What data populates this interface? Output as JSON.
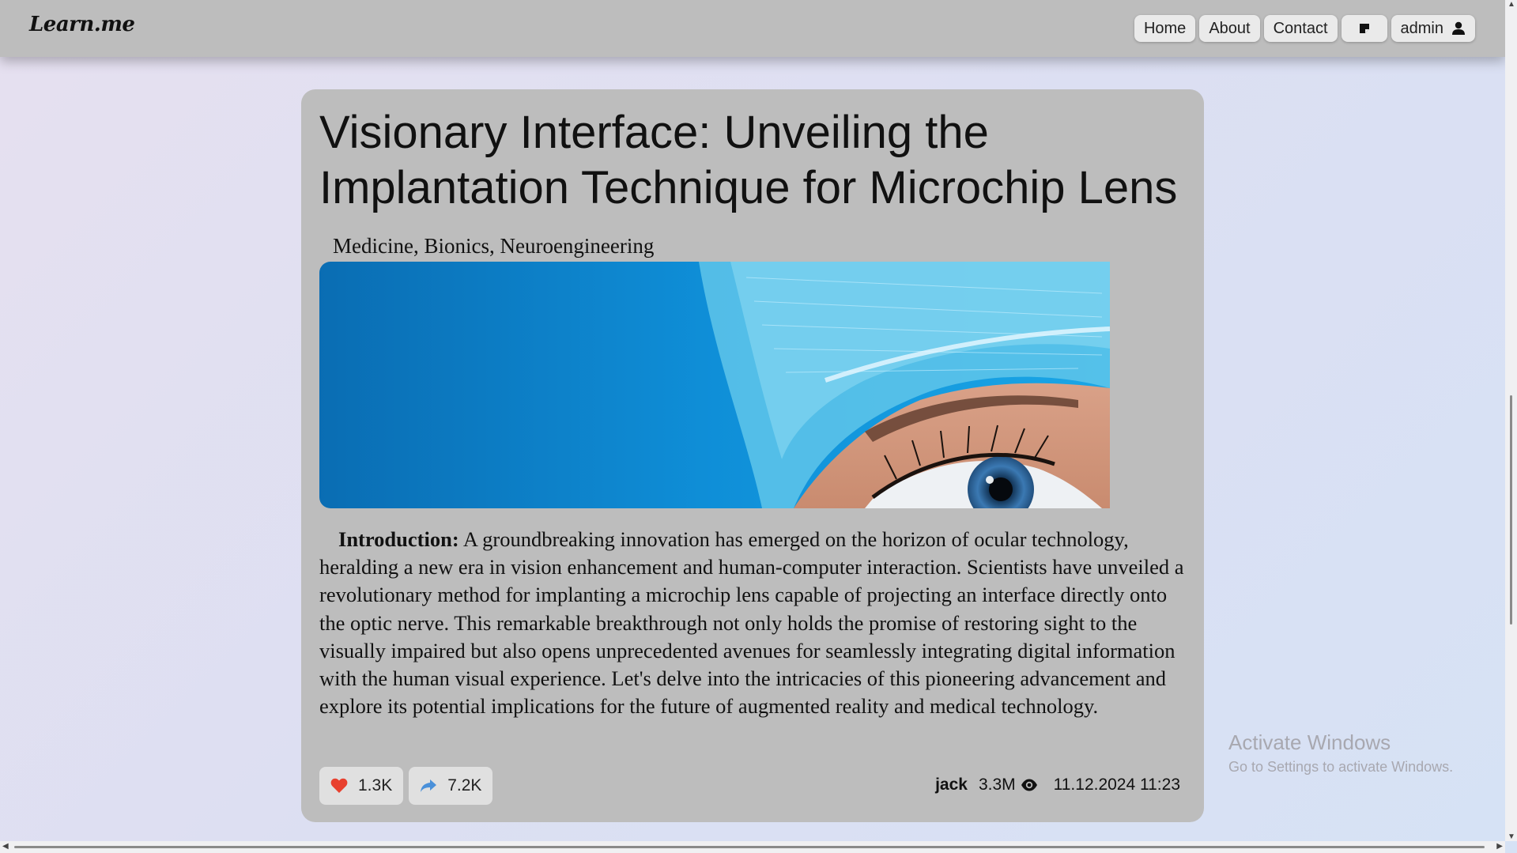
{
  "site": {
    "logo": "Learn.me"
  },
  "nav": {
    "home": "Home",
    "about": "About",
    "contact": "Contact",
    "notes_icon": "sticky-note-icon",
    "user": "admin",
    "user_icon": "user-icon"
  },
  "article": {
    "title": "Visionary Interface: Unveiling the Implantation Technique for Microchip Lens",
    "tags": "Medicine, Bionics, Neuroengineering",
    "image_alt": "Close-up of an eye below a blue surgical cap",
    "intro_label": "Introduction:",
    "intro_text": " A groundbreaking innovation has emerged on the horizon of ocular technology, heralding a new era in vision enhancement and human-computer interaction. Scientists have unveiled a revolutionary method for implanting a microchip lens capable of projecting an interface directly onto the optic nerve. This remarkable breakthrough not only holds the promise of restoring sight to the visually impaired but also opens unprecedented avenues for seamlessly integrating digital information with the human visual experience. Let's delve into the intricacies of this pioneering advancement and explore its potential implications for the future of augmented reality and medical technology.",
    "likes": "1.3K",
    "shares": "7.2K",
    "author": "jack",
    "views": "3.3M",
    "date": "11.12.2024 11:23"
  },
  "colors": {
    "like": "#e8402e",
    "share": "#4a90d9"
  },
  "watermark": {
    "line1": "Activate Windows",
    "line2": "Go to Settings to activate Windows."
  }
}
